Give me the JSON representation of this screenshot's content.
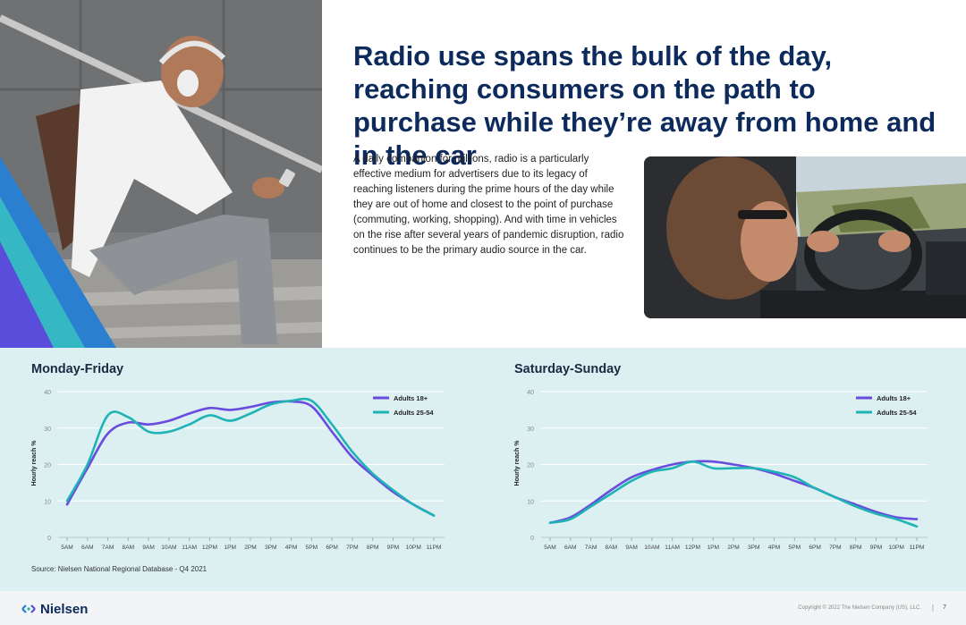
{
  "headline": "Radio use spans the bulk of the day, reaching consumers on the path to purchase while they’re away from home and in the car",
  "intro": "A daily companion for millions, radio is a particularly effective medium for advertisers due to its legacy of reaching listeners during the prime hours of the day while they are out of home and closest to the point of purchase (commuting, working, shopping). And with time in vehicles on the rise after several years of pandemic disruption, radio continues to be the primary audio source in the car.",
  "colors": {
    "adults18": "#6a4be0",
    "adults2554": "#1fb3b5",
    "headline": "#0c2a5b",
    "band": "#dcf0f1"
  },
  "chart_data": [
    {
      "type": "line",
      "title": "Monday-Friday",
      "ylabel": "Hourly reach %",
      "ylim": [
        0,
        40
      ],
      "yticks": [
        "0",
        "10",
        "20",
        "30",
        "40"
      ],
      "grid": true,
      "legend": "top-right",
      "categories": [
        "5AM",
        "6AM",
        "7AM",
        "8AM",
        "9AM",
        "10AM",
        "11AM",
        "12PM",
        "1PM",
        "2PM",
        "3PM",
        "4PM",
        "5PM",
        "6PM",
        "7PM",
        "8PM",
        "9PM",
        "10PM",
        "11PM"
      ],
      "series": [
        {
          "name": "Adults 18+",
          "values": [
            9,
            19,
            28.5,
            31.5,
            31,
            32,
            34,
            35.5,
            35,
            35.8,
            37,
            37.3,
            36,
            29,
            22,
            17,
            12.5,
            9,
            6
          ]
        },
        {
          "name": "Adults 25-54",
          "values": [
            10,
            20,
            33.5,
            33,
            29,
            29,
            31,
            33.5,
            32,
            34,
            36.5,
            37.5,
            37.5,
            31,
            23.5,
            17.5,
            13,
            9,
            6
          ]
        }
      ]
    },
    {
      "type": "line",
      "title": "Saturday-Sunday",
      "ylabel": "Hourly reach %",
      "ylim": [
        0,
        40
      ],
      "yticks": [
        "0",
        "10",
        "20",
        "30",
        "40"
      ],
      "grid": true,
      "legend": "top-right",
      "categories": [
        "5AM",
        "6AM",
        "7AM",
        "8AM",
        "9AM",
        "10AM",
        "11AM",
        "12PM",
        "1PM",
        "2PM",
        "3PM",
        "4PM",
        "5PM",
        "6PM",
        "7PM",
        "8PM",
        "9PM",
        "10PM",
        "11PM"
      ],
      "series": [
        {
          "name": "Adults 18+",
          "values": [
            4,
            5.5,
            9,
            13,
            16.5,
            18.5,
            20,
            20.8,
            20.8,
            20,
            19,
            17.5,
            15.5,
            13.5,
            11,
            9,
            7,
            5.5,
            5
          ]
        },
        {
          "name": "Adults 25-54",
          "values": [
            4,
            5,
            8.5,
            12,
            15.5,
            18,
            19,
            20.8,
            19,
            19,
            19,
            18,
            16.5,
            13.5,
            11,
            8.5,
            6.5,
            5,
            3
          ]
        }
      ]
    }
  ],
  "source": "Source: Nielsen National Regional Database - Q4 2021",
  "footer": {
    "brand": "Nielsen",
    "copyright": "Copyright © 2022 The Nielsen Company (US), LLC.",
    "separator": "|",
    "page": "7"
  }
}
